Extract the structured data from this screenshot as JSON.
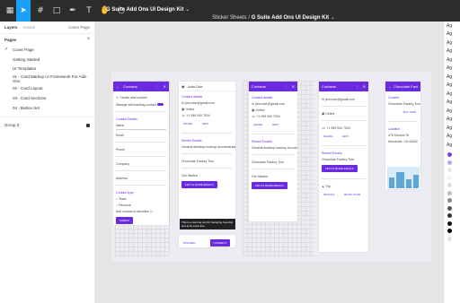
{
  "toolbar": {
    "file_title": "G Suite Add Ons UI Design Kit",
    "caret": "⌄",
    "canvas_prefix": "Sticker Sheets",
    "canvas_title": "G Suite Add Ons UI Design Kit"
  },
  "sidebar": {
    "tab_layers": "Layers",
    "tab_assets": "Assets",
    "page_switch": "Cover Page",
    "pages_label": "Pages",
    "add_page": "+",
    "pages": [
      "Cover Page",
      "Getting Started",
      "UI Templates",
      "01 - Card Markup UI Framework For Add-Ons",
      "02 - Card Layout",
      "03 - Card Sections",
      "04 - Button Set"
    ],
    "layers": [
      "Group 3"
    ]
  },
  "right_panel": {
    "rows": [
      "Ag",
      "Ag",
      "Ag",
      "Ag",
      "Ag",
      "Ag",
      "Ag",
      "Ag",
      "Ag",
      "Ag",
      "Ag",
      "Ag",
      "Ag",
      "Ag",
      "Ag"
    ],
    "swatches": [
      "#7b3fe4",
      "#b9a6f0",
      "#e8e4f5",
      "#f4f4f4",
      "#dddddd",
      "#bdbdbd",
      "#888888",
      "#555555",
      "#333333",
      "#111111",
      "#000000",
      "#e0e0e0"
    ]
  },
  "cards": {
    "c1": {
      "title": "Contacts",
      "menu_icon": "⋮",
      "close_icon": "✕",
      "new_contact": "Create new contact",
      "manage": "Manage self-tracking contact",
      "section": "Contact Details",
      "name_field": "Name",
      "email": "Email",
      "phone": "Phone",
      "company": "Company",
      "address": "Address",
      "contact_type": "Contact type",
      "team": "Team",
      "personal": "Personal",
      "add_favorites": "Add contact to favorites",
      "submit": "SUBMIT"
    },
    "c2": {
      "name": "John Doe",
      "section": "Contact details",
      "email": "john.doe@gmail.com",
      "company": "Online",
      "phone": "+1 999 000 7534",
      "share": "SHARE",
      "edit": "EDIT",
      "emails_header": "Recent Emails",
      "mail1_subject": "General desktop mockup recommendations",
      "mail2_subject": "Chocolate Factory Tour",
      "mail3_subject": "Get Started",
      "fetch": "FETCH MORE EMAILS",
      "tooltip": "This is a two line text for footsping how this text at its a two line",
      "discard": "DISCARD",
      "connect": "CONNECT"
    },
    "c3": {
      "title": "Contacts",
      "section": "Contact details",
      "email": "john.doe@gmail.com",
      "company": "Online",
      "phone": "+1 999 000 7534",
      "share": "SHARE",
      "edit": "EDIT",
      "emails_header": "Recent Emails",
      "mail1_subject": "General desktop mockup recommendations",
      "mail2_subject": "Chocolate Factory Tour",
      "mail3_subject": "Get Started",
      "fetch": "FETCH MORE EMAILS"
    },
    "c4": {
      "title": "Contacts",
      "email": "john.doe@gmail.com",
      "company": "Online",
      "phone": "+1 999 000 7534",
      "share": "SHARE",
      "edit": "EDIT",
      "emails_header": "Recent Emails",
      "mail_subject": "Chocolate Factory Tour",
      "fetch": "FETCH MORE EMAILS",
      "trip": "Trip",
      "details": "DETAILS",
      "book": "BOOK TOUR"
    },
    "c5": {
      "title": "Chocolate Factory Tour",
      "content": "Content",
      "tour_title": "Chocolate Factory Tour",
      "buy": "BUY NOW",
      "location": "Location",
      "address1": "476 Monroe St",
      "address2": "Woodside, CA 94062"
    }
  }
}
